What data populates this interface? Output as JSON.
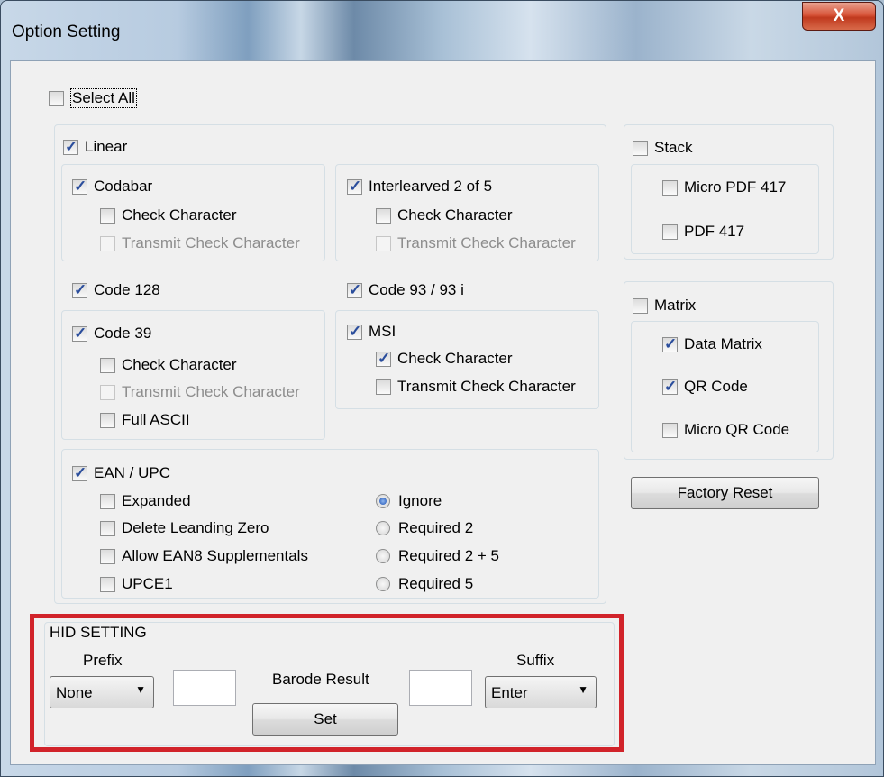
{
  "window": {
    "title": "Option Setting",
    "close_label": "X"
  },
  "select_all": {
    "label": "Select All",
    "checked": false
  },
  "linear": {
    "label": "Linear",
    "checked": true,
    "codabar": {
      "label": "Codabar",
      "checked": true,
      "check_char": "Check Character",
      "transmit": "Transmit Check Character"
    },
    "i2of5": {
      "label": "Interlearved 2 of 5",
      "checked": true,
      "check_char": "Check Character",
      "transmit": "Transmit Check Character"
    },
    "code128": {
      "label": "Code 128",
      "checked": true
    },
    "code93": {
      "label": "Code 93 / 93 i",
      "checked": true
    },
    "code39": {
      "label": "Code 39",
      "checked": true,
      "check_char": "Check Character",
      "transmit": "Transmit Check Character",
      "full_ascii": "Full ASCII"
    },
    "msi": {
      "label": "MSI",
      "checked": true,
      "check_char": "Check Character",
      "transmit": "Transmit Check Character"
    },
    "ean": {
      "label": "EAN / UPC",
      "checked": true,
      "options": [
        "Expanded",
        "Delete Leanding Zero",
        "Allow EAN8 Supplementals",
        "UPCE1"
      ],
      "radios": [
        "Ignore",
        "Required 2",
        "Required 2 + 5",
        "Required 5"
      ],
      "selected_radio": "Ignore"
    }
  },
  "stack": {
    "label": "Stack",
    "micro_pdf": "Micro PDF 417",
    "pdf": "PDF 417"
  },
  "matrix": {
    "label": "Matrix",
    "data_matrix": "Data Matrix",
    "qr": "QR Code",
    "micro_qr": "Micro QR Code"
  },
  "factory_reset": "Factory Reset",
  "hid": {
    "title": "HID SETTING",
    "prefix_label": "Prefix",
    "prefix_value": "None",
    "barcode_label": "Barode Result",
    "suffix_label": "Suffix",
    "suffix_value": "Enter",
    "set_label": "Set"
  },
  "colors": {
    "highlight": "#d1232a",
    "check": "#2a4d9c"
  }
}
